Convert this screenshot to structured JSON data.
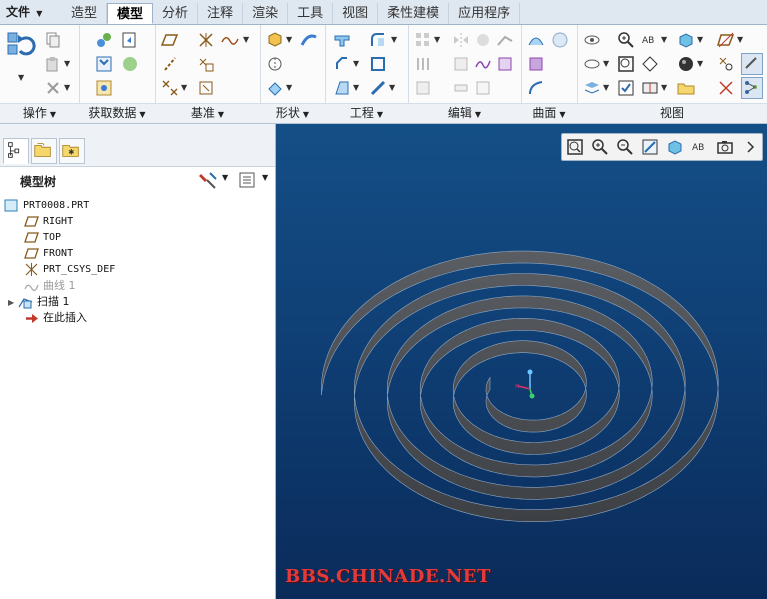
{
  "menu": {
    "file_label": "文件",
    "tabs": [
      {
        "label": "造型",
        "active": false
      },
      {
        "label": "模型",
        "active": true
      },
      {
        "label": "分析",
        "active": false
      },
      {
        "label": "注释",
        "active": false
      },
      {
        "label": "渲染",
        "active": false
      },
      {
        "label": "工具",
        "active": false
      },
      {
        "label": "视图",
        "active": false
      },
      {
        "label": "柔性建模",
        "active": false
      },
      {
        "label": "应用程序",
        "active": false
      }
    ]
  },
  "ribbon": {
    "groups": [
      {
        "label": "操作"
      },
      {
        "label": "获取数据"
      },
      {
        "label": "基准"
      },
      {
        "label": "形状"
      },
      {
        "label": "工程"
      },
      {
        "label": "编辑"
      },
      {
        "label": "曲面"
      },
      {
        "label": "视图"
      }
    ]
  },
  "model_tree": {
    "title": "模型树",
    "nodes": [
      {
        "label": "PRT0008.PRT",
        "icon": "part-icon"
      },
      {
        "label": "RIGHT",
        "icon": "datum-plane-icon"
      },
      {
        "label": "TOP",
        "icon": "datum-plane-icon"
      },
      {
        "label": "FRONT",
        "icon": "datum-plane-icon"
      },
      {
        "label": "PRT_CSYS_DEF",
        "icon": "csys-icon"
      },
      {
        "label": "曲线 1",
        "icon": "curve-icon"
      },
      {
        "label": "扫描 1",
        "icon": "sweep-icon"
      },
      {
        "label": "在此插入",
        "icon": "insert-arrow-icon"
      }
    ]
  },
  "viewport": {
    "watermark": "BBS.CHINADE.NET",
    "background_top": "#144f86",
    "background_bottom": "#0a2b5a",
    "model_color": "#4f5257"
  },
  "colors": {
    "accent": "#2b6cb0",
    "watermark": "#e33b3b"
  }
}
